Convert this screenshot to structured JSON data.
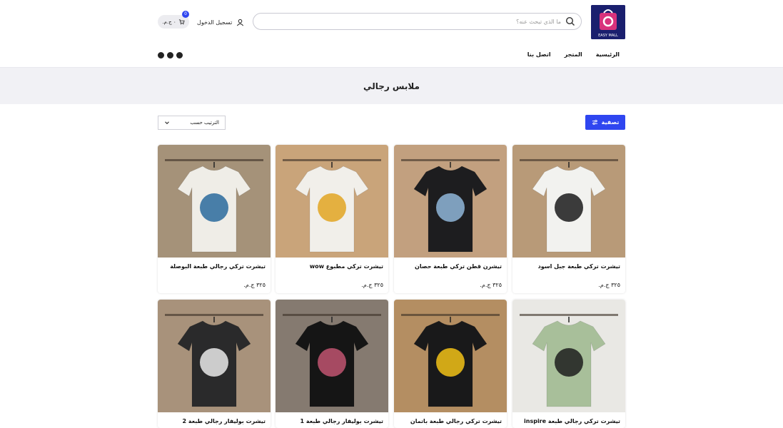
{
  "header": {
    "search_placeholder": "ما الذي تبحث عنه؟",
    "login_label": "تسجيل الدخول",
    "cart_total": "٠ ج.م.",
    "cart_count": "0",
    "logo_text": "EASY MALL"
  },
  "nav": {
    "items": [
      {
        "label": "الرئيسية"
      },
      {
        "label": "المتجر"
      },
      {
        "label": "اتصل بنا"
      }
    ]
  },
  "social": [
    "facebook-icon",
    "instagram-icon",
    "telegram-icon"
  ],
  "page": {
    "title": "ملابس رجالي"
  },
  "toolbar": {
    "filter_label": "تصفية",
    "sort_label": "الترتيب حسب"
  },
  "products": [
    {
      "title": "تيشرت تركي طبعة جبل اسود",
      "price": "٣٢٥ ج.م.",
      "image": "white-tshirt-mountain",
      "bg": "#b89a78",
      "shirt": "#f2f2ef",
      "print": "#1b1b1b"
    },
    {
      "title": "تيشرن قطن تركي طبعة حصان",
      "price": "٣٢٥ ج.م.",
      "image": "black-tshirt-horse-wave",
      "bg": "#c2a07f",
      "shirt": "#1d1d1f",
      "print": "#8fb6d9"
    },
    {
      "title": "تيشرت تركي مطبوع wow",
      "price": "٣٢٥ ج.م.",
      "image": "white-tshirt-wow",
      "bg": "#c9a47a",
      "shirt": "#f1efea",
      "print": "#e2a422"
    },
    {
      "title": "تيشرت تركي رجالي طبعة البوصلة",
      "price": "٣٢٥ ج.م.",
      "image": "white-tshirt-compass",
      "bg": "#a59279",
      "shirt": "#efede7",
      "print": "#2a6a9c"
    },
    {
      "title": "تيشرت تركي رجالي طبعة inspire",
      "price": "",
      "image": "green-tshirt-inspire",
      "bg": "#e9e8e4",
      "shirt": "#a8bf9a",
      "print": "#1d1d1d"
    },
    {
      "title": "تيشرت تركي رجالي طبعة باتمان",
      "price": "",
      "image": "black-tshirt-batman",
      "bg": "#b48e62",
      "shirt": "#19191a",
      "print": "#f2c218"
    },
    {
      "title": "تيشرت بوليفار رجالي طبعة 1",
      "price": "",
      "image": "black-tshirts-print-1",
      "bg": "#857a70",
      "shirt": "#151515",
      "print": "#c05470"
    },
    {
      "title": "تيشرت بوليفار رجالي طبعة 2",
      "price": "",
      "image": "black-tshirts-print-2",
      "bg": "#a8927b",
      "shirt": "#2a2a2b",
      "print": "#e9e9e9"
    }
  ]
}
